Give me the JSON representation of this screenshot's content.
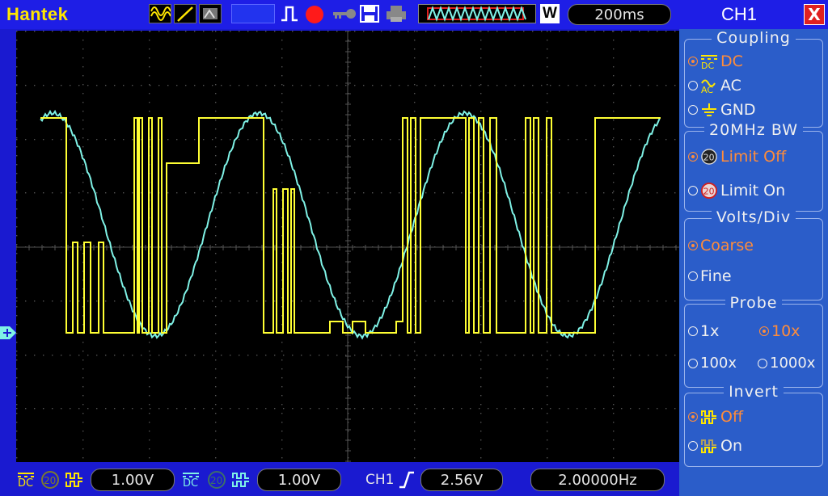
{
  "brand": "Hantek",
  "toolbar": {
    "timebase_label": "W",
    "timebase_value": "200ms"
  },
  "bottom": {
    "ch1_scale": "1.00V",
    "ch2_scale": "1.00V",
    "trigger_source": "CH1",
    "trigger_level": "2.56V",
    "frequency": "2.00000Hz"
  },
  "panel": {
    "title": "CH1",
    "close_label": "X",
    "coupling": {
      "title": "Coupling",
      "options": [
        "DC",
        "AC",
        "GND"
      ],
      "selected": "DC"
    },
    "bw": {
      "title": "20MHz BW",
      "options": [
        "Limit Off",
        "Limit On"
      ],
      "selected": "Limit Off"
    },
    "volts": {
      "title": "Volts/Div",
      "options": [
        "Coarse",
        "Fine"
      ],
      "selected": "Coarse"
    },
    "probe": {
      "title": "Probe",
      "options": [
        "1x",
        "10x",
        "100x",
        "1000x"
      ],
      "selected": "10x"
    },
    "invert": {
      "title": "Invert",
      "options": [
        "Off",
        "On"
      ],
      "selected": "Off"
    }
  },
  "colors": {
    "ch1": "#ffff33",
    "ch2": "#7ff2e6",
    "accent": "#ff8c3a",
    "panel": "#2b5dc9",
    "bar": "#1e1ee6"
  }
}
